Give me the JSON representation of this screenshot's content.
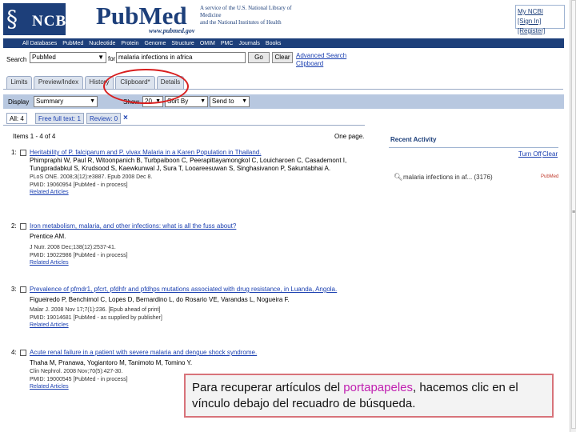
{
  "header": {
    "ncbi_logo": "NCBI",
    "pubmed_logo": "PubMed",
    "pubmed_url": "www.pubmed.gov",
    "nlm_line1": "A service of the U.S. National Library of Medicine",
    "nlm_line2": "and the National Institutes of Health",
    "my_ncbi": "My NCBI",
    "sign_in": "[Sign In]",
    "register": "[Register]"
  },
  "db_bar": [
    "All Databases",
    "PubMed",
    "Nucleotide",
    "Protein",
    "Genome",
    "Structure",
    "OMIM",
    "PMC",
    "Journals",
    "Books"
  ],
  "search": {
    "label": "Search",
    "db": "PubMed",
    "for": "for",
    "query": "malaria infections in africa",
    "go": "Go",
    "clear": "Clear",
    "advanced": "Advanced Search",
    "clipboard": "Clipboard"
  },
  "tabs": [
    "Limits",
    "Preview/Index",
    "History",
    "Clipboard*",
    "Details"
  ],
  "display_bar": {
    "display_label": "Display",
    "display_value": "Summary",
    "show_label": "Show",
    "show_value": "20",
    "sort_value": "Sort By",
    "send_value": "Send to"
  },
  "filter_tabs": [
    "All: 4",
    "Free full text: 1",
    "Review: 0"
  ],
  "results": {
    "items": "Items 1 - 4 of 4",
    "one_page": "One page.",
    "list": [
      {
        "num": "1:",
        "title": "Heritability of P. falciparum and P. vivax Malaria in a Karen Population in Thailand.",
        "authors": "Phimpraphi W, Paul R, Witoonpanich B, Turbpaiboon C, Peerapittayamongkol C, Louicharoen C, Casademont I, Tungpradabkul S, Krudsood S, Kaewkunwal J, Sura T, Looareesuwan S, Singhasivanon P, Sakuntabhai A.",
        "source": "PLoS ONE. 2008;3(12):e3887. Epub 2008 Dec 8.",
        "pmid": "PMID: 19060954 [PubMed - in process]",
        "related": "Related Articles"
      },
      {
        "num": "2:",
        "title": "Iron metabolism, malaria, and other infections: what is all the fuss about?",
        "authors": "Prentice AM.",
        "source": "J Nutr. 2008 Dec;138(12):2537-41.",
        "pmid": "PMID: 19022986 [PubMed - in process]",
        "related": "Related Articles"
      },
      {
        "num": "3:",
        "title": "Prevalence of pfmdr1, pfcrt, pfdhfr and pfdhps mutations associated with drug resistance, in Luanda, Angola.",
        "authors": "Figueiredo P, Benchimol C, Lopes D, Bernardino L, do Rosario VE, Varandas L, Nogueira F.",
        "source": "Malar J. 2008 Nov 17;7(1):236. [Epub ahead of print]",
        "pmid": "PMID: 19014681 [PubMed - as supplied by publisher]",
        "related": "Related Articles"
      },
      {
        "num": "4:",
        "title": "Acute renal failure in a patient with severe malaria and dengue shock syndrome.",
        "authors": "Thaha M, Pranawa, Yogiantoro M, Tanimoto M, Tomino Y.",
        "source": "Clin Nephrol. 2008 Nov;70(5):427-30.",
        "pmid": "PMID: 19000545 [PubMed - in process]",
        "related": "Related Articles"
      }
    ]
  },
  "recent": {
    "title": "Recent Activity",
    "turn_off": "Turn Off",
    "clear": "Clear",
    "query": "malaria infections in af... (3176)",
    "db": "PubMed"
  },
  "callout": {
    "part1": "Para recuperar artículos del ",
    "highlight": "portapapeles",
    "part2": ", hacemos clic en el vínculo debajo del recuadro de búsqueda."
  },
  "colors": {
    "ncbi_blue": "#1d3f7a",
    "link_blue": "#1a3fb0",
    "annotation_red": "#d81e1e",
    "highlight_magenta": "#c01fb0"
  }
}
